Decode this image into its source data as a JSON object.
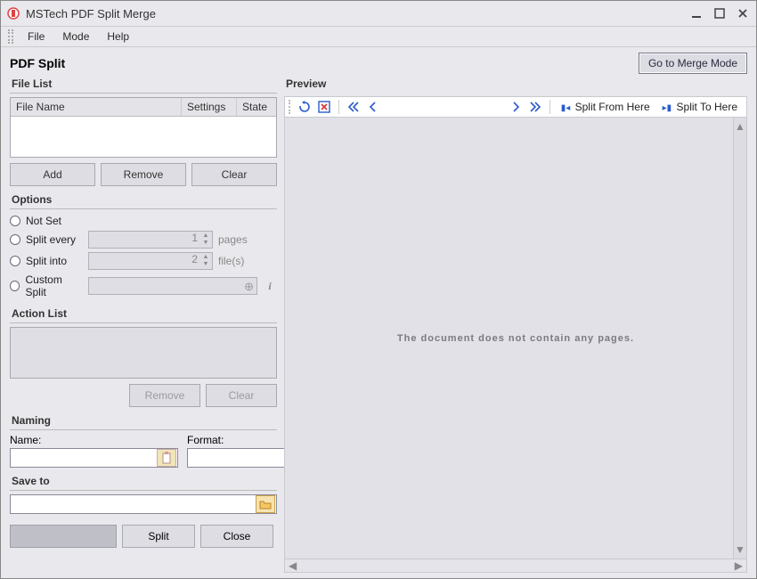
{
  "title": "MSTech PDF Split Merge",
  "menu": {
    "file": "File",
    "mode": "Mode",
    "help": "Help"
  },
  "page_title": "PDF Split",
  "merge_mode_btn": "Go to Merge Mode",
  "file_list": {
    "header": "File List",
    "cols": {
      "name": "File Name",
      "settings": "Settings",
      "state": "State"
    },
    "buttons": {
      "add": "Add",
      "remove": "Remove",
      "clear": "Clear"
    }
  },
  "options": {
    "header": "Options",
    "not_set": "Not Set",
    "split_every": {
      "label": "Split every",
      "value": "1",
      "suffix": "pages"
    },
    "split_into": {
      "label": "Split into",
      "value": "2",
      "suffix": "file(s)"
    },
    "custom": "Custom Split"
  },
  "action_list": {
    "header": "Action List",
    "buttons": {
      "remove": "Remove",
      "clear": "Clear"
    }
  },
  "naming": {
    "header": "Naming",
    "name_label": "Name:",
    "format_label": "Format:"
  },
  "save_to": {
    "header": "Save to"
  },
  "bottom": {
    "split": "Split",
    "close": "Close"
  },
  "preview": {
    "header": "Preview",
    "split_from": "Split From Here",
    "split_to": "Split To Here",
    "empty_msg": "The document does not contain any pages."
  }
}
